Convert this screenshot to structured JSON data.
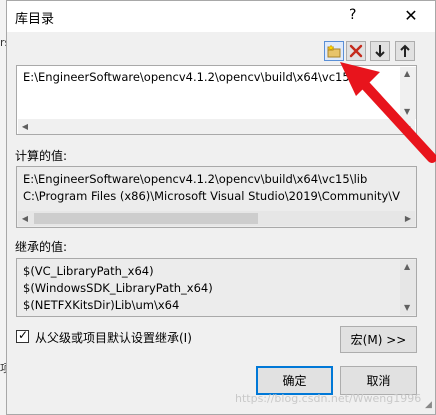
{
  "background": {
    "left_texts": [
      "rs",
      "项"
    ]
  },
  "dialog": {
    "title": "库目录",
    "help_glyph": "?",
    "close_glyph": "✕"
  },
  "toolbar": {
    "icons": [
      "new-line-icon",
      "delete-icon",
      "move-down-icon",
      "move-up-icon"
    ]
  },
  "edit_box": {
    "value": "E:\\EngineerSoftware\\opencv4.1.2\\opencv\\build\\x64\\vc15\\lib"
  },
  "computed": {
    "label": "计算的值:",
    "lines": [
      "E:\\EngineerSoftware\\opencv4.1.2\\opencv\\build\\x64\\vc15\\lib",
      "C:\\Program Files (x86)\\Microsoft Visual Studio\\2019\\Community\\V"
    ]
  },
  "inherited": {
    "label": "继承的值:",
    "lines": [
      "$(VC_LibraryPath_x64)",
      "$(WindowsSDK_LibraryPath_x64)",
      "$(NETFXKitsDir)Lib\\um\\x64"
    ]
  },
  "inherit_checkbox": {
    "label": "从父级或项目默认设置继承(I)",
    "checked": true,
    "mark": "✓"
  },
  "buttons": {
    "macro": "宏(M) >>",
    "ok": "确定",
    "cancel": "取消"
  },
  "watermark": "https://blog.csdn.net/Wweng1996",
  "colors": {
    "annotation_arrow": "#e8141c",
    "focus_border": "#0078d7",
    "delete_icon": "#c42b1c"
  }
}
